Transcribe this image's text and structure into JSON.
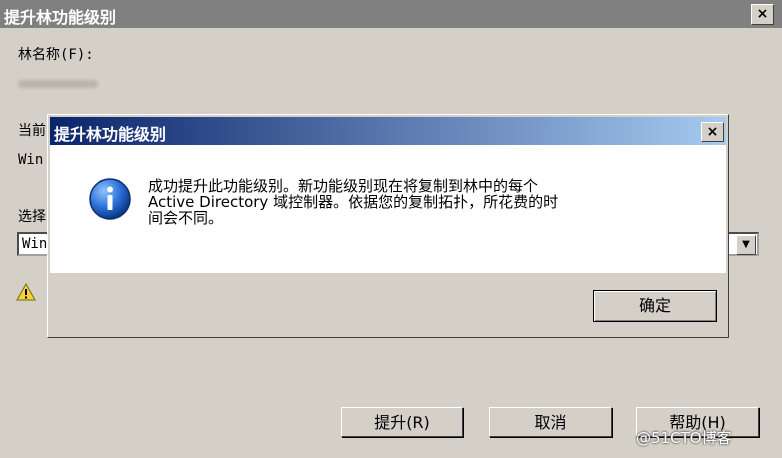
{
  "background_window": {
    "title": "提升林功能级别",
    "close": "×",
    "forest_name_label": "林名称(F):",
    "current_level_label_partial": "当前",
    "current_level_value_partial": "Win",
    "select_label_partial": "选择",
    "select_value_partial": "Win",
    "buttons": {
      "raise": "提升(R)",
      "cancel": "取消",
      "help": "帮助(H)"
    }
  },
  "dialog": {
    "title": "提升林功能级别",
    "close": "×",
    "message": "成功提升此功能级别。新功能级别现在将复制到林中的每个\nActive Directory 域控制器。依据您的复制拓扑，所花费的时\n间会不同。",
    "ok_label": "确定",
    "icon": "info-icon"
  },
  "watermark": "@51CTO博客",
  "colors": {
    "dialog_title_start": "#0a246a",
    "dialog_title_end": "#a6caf0",
    "window_bg": "#d4d0c8",
    "inactive_title": "#808080"
  }
}
